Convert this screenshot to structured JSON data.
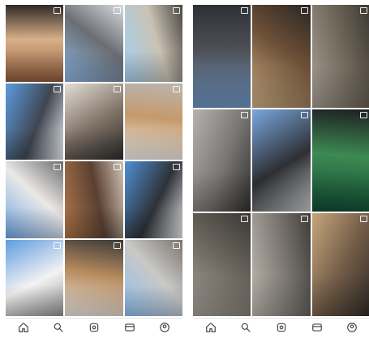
{
  "screens": [
    {
      "name": "left-screen",
      "tiles": [
        {
          "colors": [
            "#8c5a3a",
            "#d9b089",
            "#2e2a26"
          ],
          "caption": ""
        },
        {
          "colors": [
            "#8fb8e6",
            "#6b6e73",
            "#d8dce0"
          ],
          "caption": ""
        },
        {
          "colors": [
            "#a5d0f0",
            "#c9c2b3",
            "#4a4640"
          ],
          "caption": ""
        },
        {
          "colors": [
            "#5c9be0",
            "#3f4650",
            "#e9eef2"
          ],
          "caption": ""
        },
        {
          "colors": [
            "#e4ded6",
            "#7b6e62",
            "#2b2b2b"
          ],
          "caption": ""
        },
        {
          "colors": [
            "#f2f0ed",
            "#c59a6b",
            "#b9b5b0"
          ],
          "caption": ""
        },
        {
          "colors": [
            "#6ea4e3",
            "#ebe9e6",
            "#6b6c70"
          ],
          "caption": ""
        },
        {
          "colors": [
            "#b07648",
            "#5a4032",
            "#cfc2b3"
          ],
          "caption": ""
        },
        {
          "colors": [
            "#4f8fd6",
            "#2e3237",
            "#e7e8e9"
          ],
          "caption": ""
        },
        {
          "colors": [
            "#5f9be0",
            "#f3f3f3",
            "#8d8e91"
          ],
          "caption": ""
        },
        {
          "colors": [
            "#eeeae5",
            "#b78b5d",
            "#3a3a3a"
          ],
          "caption": ""
        },
        {
          "colors": [
            "#8fbef0",
            "#c9c8c6",
            "#7b756f"
          ],
          "caption": ""
        }
      ]
    },
    {
      "name": "right-screen",
      "tiles": [
        {
          "colors": [
            "#6f95c2",
            "#4e5258",
            "#2d3135"
          ],
          "caption": ""
        },
        {
          "colors": [
            "#cfb186",
            "#6e5038",
            "#2a2623"
          ],
          "caption": ""
        },
        {
          "colors": [
            "#a79f95",
            "#6f6759",
            "#3c3833"
          ],
          "caption": ""
        },
        {
          "colors": [
            "#b5b2ae",
            "#777572",
            "#2f2e2d"
          ],
          "caption": ""
        },
        {
          "colors": [
            "#7aa8e0",
            "#2d2f33",
            "#c7c8ca"
          ],
          "caption": ""
        },
        {
          "colors": [
            "#0f4a33",
            "#3d8a52",
            "#1d1f22"
          ],
          "caption": ""
        },
        {
          "colors": [
            "#a8a39b",
            "#6a645c",
            "#3a3836"
          ],
          "caption": ""
        },
        {
          "colors": [
            "#bdb8b0",
            "#7b7670",
            "#3f3c39"
          ],
          "caption": ""
        },
        {
          "colors": [
            "#c7a57c",
            "#6f5a46",
            "#2f2b27"
          ],
          "caption": ""
        }
      ]
    }
  ],
  "tabbar": {
    "icons": [
      "home-icon",
      "search-icon",
      "bookmark-icon",
      "chat-icon",
      "profile-icon"
    ],
    "labels": [
      "",
      "",
      "",
      "",
      ""
    ]
  }
}
